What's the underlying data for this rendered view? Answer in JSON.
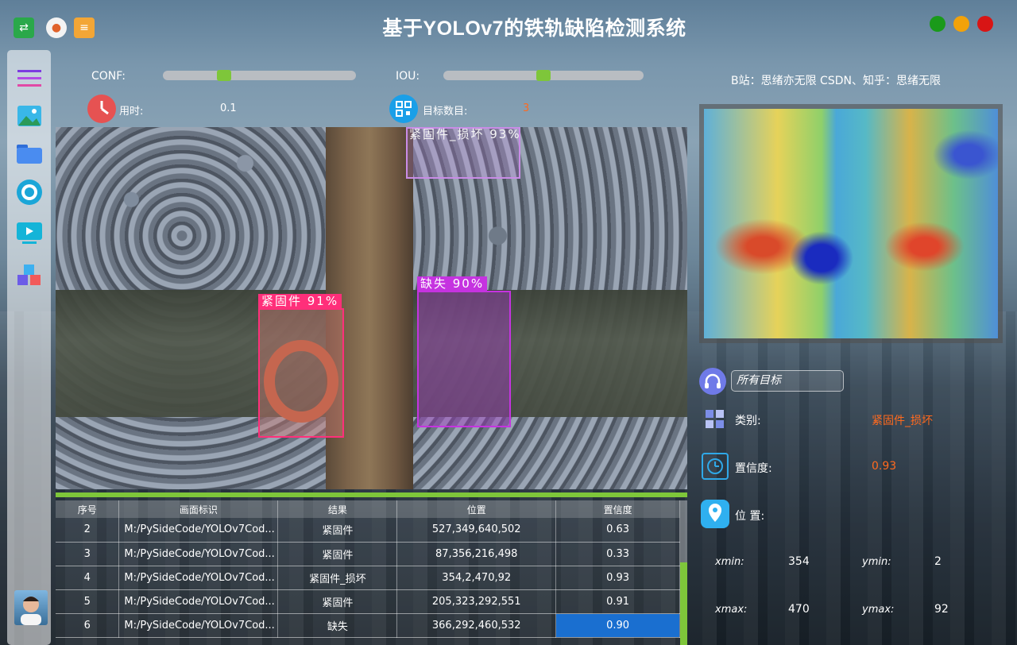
{
  "app": {
    "title": "基于YOLOv7的铁轨缺陷检测系统",
    "credit": "B站：思绪亦无限  CSDN、知乎：思绪无限"
  },
  "window_controls": {
    "colors": [
      "#1a9a1a",
      "#f2a20a",
      "#d81515"
    ]
  },
  "controls": {
    "conf_label": "CONF:",
    "iou_label": "IOU:",
    "conf_value": 0.3,
    "iou_value": 0.5,
    "time_label": "用时:",
    "time_value": "0.1",
    "count_label": "目标数目:",
    "count_value": "3"
  },
  "sidebar": {
    "items": [
      "menu-icon",
      "image-icon",
      "folder-icon",
      "camera-icon",
      "video-icon",
      "model-icon"
    ]
  },
  "detections": [
    {
      "label": "紧固件_损坏 93%",
      "color": "#c98ce6"
    },
    {
      "label": "紧固件 91%",
      "color": "#ff2f7a"
    },
    {
      "label": "缺失 90%",
      "color": "#c533e0"
    }
  ],
  "table": {
    "headers": [
      "序号",
      "画面标识",
      "结果",
      "位置",
      "置信度"
    ],
    "rows": [
      [
        "2",
        "M:/PySideCode/YOLOv7Cod...",
        "紧固件",
        "527,349,640,502",
        "0.63"
      ],
      [
        "3",
        "M:/PySideCode/YOLOv7Cod...",
        "紧固件",
        "87,356,216,498",
        "0.33"
      ],
      [
        "4",
        "M:/PySideCode/YOLOv7Cod...",
        "紧固件_损坏",
        "354,2,470,92",
        "0.93"
      ],
      [
        "5",
        "M:/PySideCode/YOLOv7Cod...",
        "紧固件",
        "205,323,292,551",
        "0.91"
      ],
      [
        "6",
        "M:/PySideCode/YOLOv7Cod...",
        "缺失",
        "366,292,460,532",
        "0.90"
      ]
    ]
  },
  "target_panel": {
    "select_value": "所有目标",
    "class_label": "类别:",
    "class_value": "紧固件_损坏",
    "conf_label": "置信度:",
    "conf_value": "0.93",
    "pos_label": "位 置:",
    "xmin_label": "xmin:",
    "xmin": "354",
    "ymin_label": "ymin:",
    "ymin": "2",
    "xmax_label": "xmax:",
    "xmax": "470",
    "ymax_label": "ymax:",
    "ymax": "92"
  }
}
